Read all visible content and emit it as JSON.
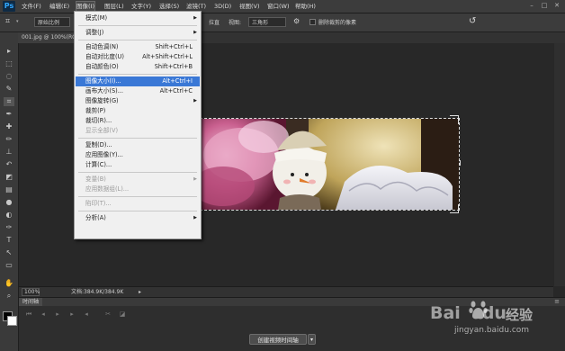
{
  "app": {
    "logo": "Ps"
  },
  "menubar": {
    "items": [
      {
        "label": "文件(F)"
      },
      {
        "label": "编辑(E)"
      },
      {
        "label": "图像(I)"
      },
      {
        "label": "图层(L)"
      },
      {
        "label": "文字(Y)"
      },
      {
        "label": "选择(S)"
      },
      {
        "label": "滤镜(T)"
      },
      {
        "label": "3D(D)"
      },
      {
        "label": "视图(V)"
      },
      {
        "label": "窗口(W)"
      },
      {
        "label": "帮助(H)"
      }
    ],
    "controls": {
      "minimize": "–",
      "maximize": "□",
      "close": "✕"
    }
  },
  "optionsbar": {
    "mode_value": "原始比例",
    "text_3": "拉直",
    "view_label": "视图:",
    "view_value": "三角形",
    "delete_cropped_label": "删除裁剪的像素"
  },
  "document": {
    "tab_label": "001.jpg @ 100%(RGB/8)"
  },
  "statusbar": {
    "zoom": "100%",
    "doc_info": "文档:384.9K/384.9K"
  },
  "timeline": {
    "tab_label": "时间轴",
    "create_button": "创建视频时间轴",
    "dropdown_arrow": "▾"
  },
  "image_menu": {
    "items": [
      {
        "label": "模式(M)",
        "shortcut": "",
        "submenu": true,
        "disabled": false
      },
      {
        "sep": true
      },
      {
        "label": "调整(J)",
        "shortcut": "",
        "submenu": true,
        "disabled": false
      },
      {
        "sep": true
      },
      {
        "label": "自动色调(N)",
        "shortcut": "Shift+Ctrl+L",
        "disabled": false
      },
      {
        "label": "自动对比度(U)",
        "shortcut": "Alt+Shift+Ctrl+L",
        "disabled": false
      },
      {
        "label": "自动颜色(O)",
        "shortcut": "Shift+Ctrl+B",
        "disabled": false
      },
      {
        "sep": true
      },
      {
        "label": "图像大小(I)...",
        "shortcut": "Alt+Ctrl+I",
        "disabled": false,
        "highlighted": true
      },
      {
        "label": "画布大小(S)...",
        "shortcut": "Alt+Ctrl+C",
        "disabled": false
      },
      {
        "label": "图像旋转(G)",
        "shortcut": "",
        "submenu": true,
        "disabled": false
      },
      {
        "label": "裁剪(P)",
        "shortcut": "",
        "disabled": false
      },
      {
        "label": "裁切(R)...",
        "shortcut": "",
        "disabled": false
      },
      {
        "label": "显示全部(V)",
        "shortcut": "",
        "disabled": true
      },
      {
        "sep": true
      },
      {
        "label": "复制(D)...",
        "shortcut": "",
        "disabled": false
      },
      {
        "label": "应用图像(Y)...",
        "shortcut": "",
        "disabled": false
      },
      {
        "label": "计算(C)...",
        "shortcut": "",
        "disabled": false
      },
      {
        "sep": true
      },
      {
        "label": "变量(B)",
        "shortcut": "",
        "submenu": true,
        "disabled": true
      },
      {
        "label": "应用数据组(L)...",
        "shortcut": "",
        "disabled": true
      },
      {
        "sep": true
      },
      {
        "label": "陷印(T)...",
        "shortcut": "",
        "disabled": true
      },
      {
        "sep": true
      },
      {
        "label": "分析(A)",
        "shortcut": "",
        "submenu": true,
        "disabled": false
      }
    ]
  },
  "watermark": {
    "brand": "Bai",
    "brand2": "du",
    "jingyan": "经验",
    "url": "jingyan.baidu.com"
  }
}
